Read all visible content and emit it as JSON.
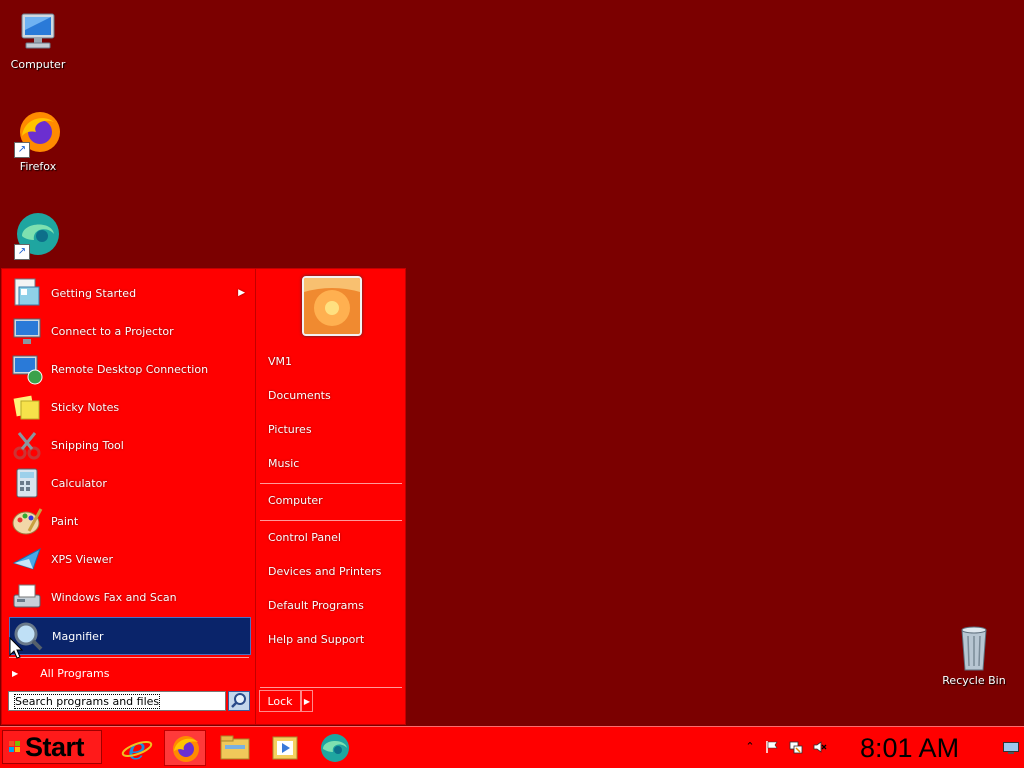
{
  "desktop": {
    "icons": [
      {
        "label": "Computer",
        "icon": "computer-icon"
      },
      {
        "label": "Firefox",
        "icon": "firefox-icon"
      },
      {
        "label": "",
        "icon": "edge-icon"
      },
      {
        "label": "Recycle Bin",
        "icon": "recycle-bin-icon"
      }
    ]
  },
  "start_menu": {
    "programs": [
      {
        "label": "Getting Started",
        "icon": "getting-started-icon",
        "has_submenu": true
      },
      {
        "label": "Connect to a Projector",
        "icon": "projector-icon"
      },
      {
        "label": "Remote Desktop Connection",
        "icon": "remote-desktop-icon"
      },
      {
        "label": "Sticky Notes",
        "icon": "sticky-notes-icon"
      },
      {
        "label": "Snipping Tool",
        "icon": "snipping-tool-icon"
      },
      {
        "label": "Calculator",
        "icon": "calculator-icon"
      },
      {
        "label": "Paint",
        "icon": "paint-icon"
      },
      {
        "label": "XPS Viewer",
        "icon": "xps-viewer-icon"
      },
      {
        "label": "Windows Fax and Scan",
        "icon": "fax-scan-icon"
      },
      {
        "label": "Magnifier",
        "icon": "magnifier-icon",
        "selected": true
      }
    ],
    "all_programs": "All Programs",
    "search_placeholder": "Search programs and files",
    "places": [
      {
        "label": "VM1"
      },
      {
        "label": "Documents"
      },
      {
        "label": "Pictures"
      },
      {
        "label": "Music"
      },
      {
        "label": "Computer"
      },
      {
        "label": "Control Panel"
      },
      {
        "label": "Devices and Printers"
      },
      {
        "label": "Default Programs"
      },
      {
        "label": "Help and Support"
      }
    ],
    "lock_label": "Lock"
  },
  "taskbar": {
    "start_label": "Start",
    "pinned": [
      "internet-explorer-icon",
      "firefox-icon",
      "file-explorer-icon",
      "media-player-icon",
      "edge-icon"
    ],
    "tray": [
      "show-hidden-icons-icon",
      "action-center-flag-icon",
      "network-icon",
      "volume-muted-icon"
    ],
    "clock": "8:01 AM"
  },
  "colors": {
    "desktop_background": "#7b0000",
    "start_menu_background": "#ff0000",
    "taskbar_background": "#ff0000",
    "selection": "#0a246a"
  }
}
